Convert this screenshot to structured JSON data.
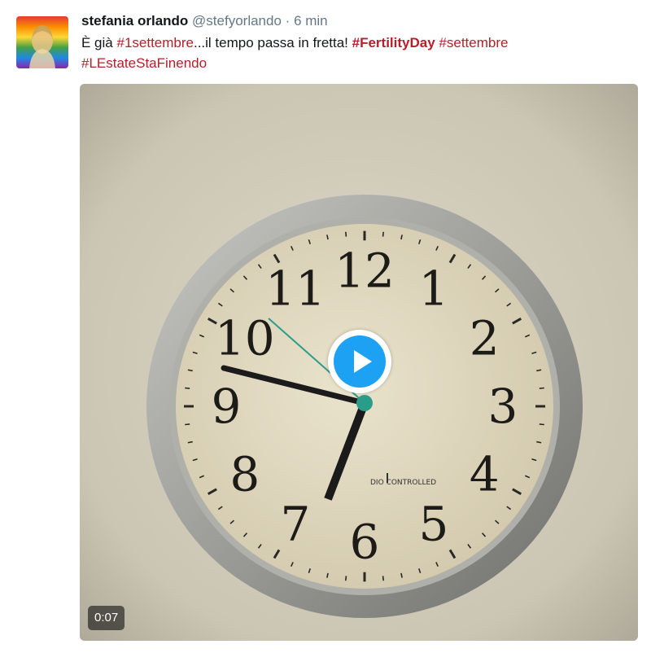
{
  "tweet": {
    "author_name": "stefania orlando",
    "handle": "@stefyorlando",
    "separator": "·",
    "time": "6 min",
    "text_segments": [
      {
        "type": "text",
        "value": "È già "
      },
      {
        "type": "hashtag",
        "value": "#1settembre"
      },
      {
        "type": "text",
        "value": "...il tempo passa in fretta! "
      },
      {
        "type": "hashtag_bold",
        "value": "#FertilityDay"
      },
      {
        "type": "text",
        "value": " "
      },
      {
        "type": "hashtag",
        "value": "#settembre"
      },
      {
        "type": "text",
        "value": " "
      },
      {
        "type": "hashtag",
        "value": "#LEstateStaFinendo"
      }
    ]
  },
  "media": {
    "type": "video",
    "duration": "0:07",
    "clock_numerals": [
      "12",
      "1",
      "2",
      "3",
      "4",
      "5",
      "6",
      "7",
      "8",
      "9",
      "10",
      "11"
    ],
    "clock_label": "DIO CONTROLLED"
  },
  "colors": {
    "hashtag": "#b5202a",
    "play_button": "#1da1f2",
    "muted_text": "#657786"
  },
  "icons": {
    "play": "play-icon",
    "avatar": "profile-avatar"
  }
}
